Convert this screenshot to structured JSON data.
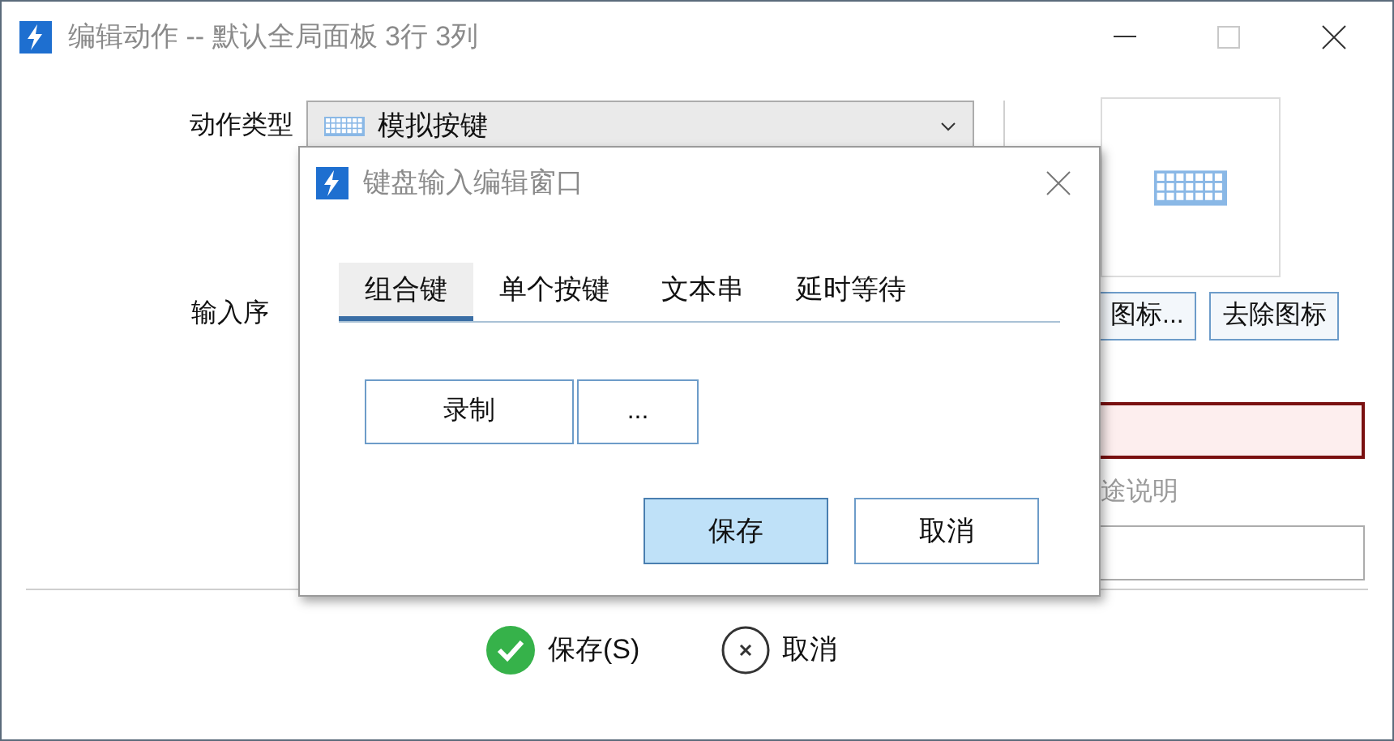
{
  "window": {
    "title": "编辑动作 -- 默认全局面板 3行 3列"
  },
  "action_type": {
    "label": "动作类型",
    "value": "模拟按键"
  },
  "input_sequence": {
    "label": "输入序"
  },
  "icon_buttons": [
    "图标...",
    "去除图标"
  ],
  "required_field": {
    "invalid": true
  },
  "description": {
    "label": "途说明"
  },
  "footer_buttons": [
    {
      "kind": "save",
      "label": "保存(S)"
    },
    {
      "kind": "cancel",
      "label": "取消"
    }
  ],
  "dialog": {
    "title": "键盘输入编辑窗口",
    "tabs": [
      {
        "label": "组合键",
        "selected": true
      },
      {
        "label": "单个按键",
        "selected": false
      },
      {
        "label": "文本串",
        "selected": false
      },
      {
        "label": "延时等待",
        "selected": false
      }
    ],
    "buttons": [
      "录制",
      "..."
    ],
    "actions": [
      {
        "label": "保存",
        "default": true
      },
      {
        "label": "取消",
        "default": false
      }
    ]
  }
}
